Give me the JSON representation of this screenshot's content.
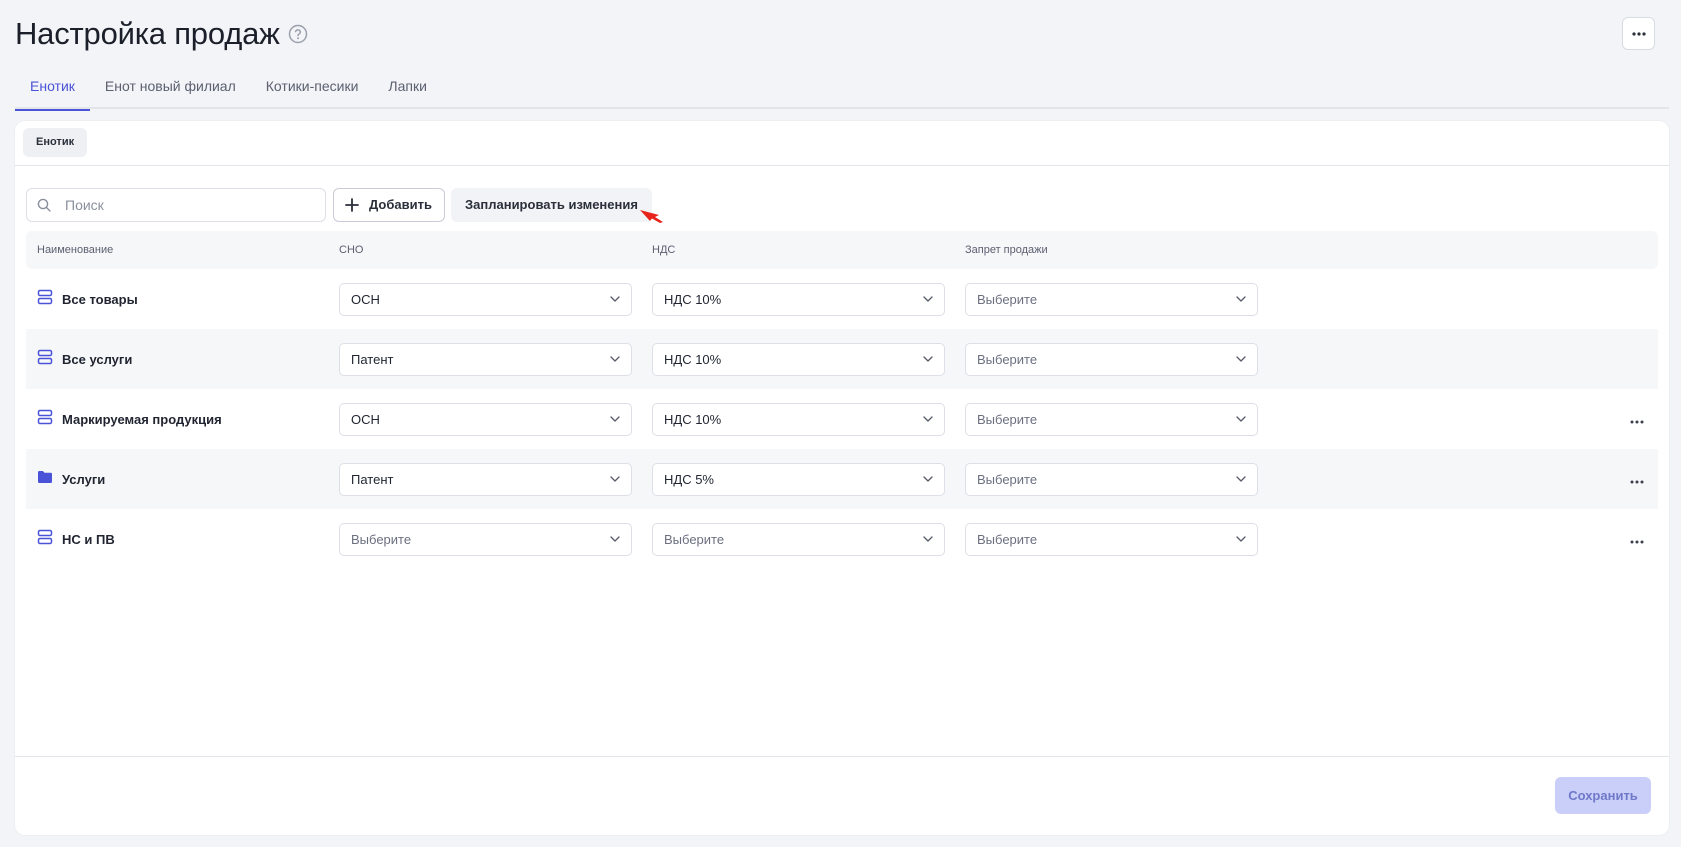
{
  "page": {
    "title": "Настройка продаж",
    "help_icon": "question-circle-icon",
    "more_icon": "more-horizontal-icon"
  },
  "tabs": [
    {
      "label": "Енотик",
      "active": true
    },
    {
      "label": "Енот новый филиал",
      "active": false
    },
    {
      "label": "Котики-песики",
      "active": false
    },
    {
      "label": "Лапки",
      "active": false
    }
  ],
  "subtabs": [
    {
      "label": "Енотик"
    }
  ],
  "toolbar": {
    "search_placeholder": "Поиск",
    "add_label": "Добавить",
    "plan_label": "Запланировать изменения"
  },
  "table": {
    "headers": {
      "name": "Наименование",
      "sno": "СНО",
      "nds": "НДС",
      "zapret": "Запрет продажи"
    },
    "rows": [
      {
        "icon": "list-group-icon",
        "name": "Все товары",
        "sno": "ОСН",
        "nds": "НДС 10%",
        "zapret": "Выберите",
        "more": false
      },
      {
        "icon": "list-group-icon",
        "name": "Все услуги",
        "sno": "Патент",
        "nds": "НДС 10%",
        "zapret": "Выберите",
        "more": false
      },
      {
        "icon": "list-group-icon",
        "name": "Маркируемая продукция",
        "sno": "ОСН",
        "nds": "НДС 10%",
        "zapret": "Выберите",
        "more": true
      },
      {
        "icon": "folder-icon",
        "name": "Услуги",
        "sno": "Патент",
        "nds": "НДС 5%",
        "zapret": "Выберите",
        "more": true
      },
      {
        "icon": "list-group-icon",
        "name": "НС и ПВ",
        "sno": "Выберите",
        "nds": "Выберите",
        "zapret": "Выберите",
        "more": true
      }
    ]
  },
  "footer": {
    "save_label": "Сохранить"
  },
  "colors": {
    "accent": "#4a52d8",
    "save_disabled_bg": "#c9cff8",
    "folder_icon": "#4a52d8",
    "cursor": "#e8231a"
  }
}
